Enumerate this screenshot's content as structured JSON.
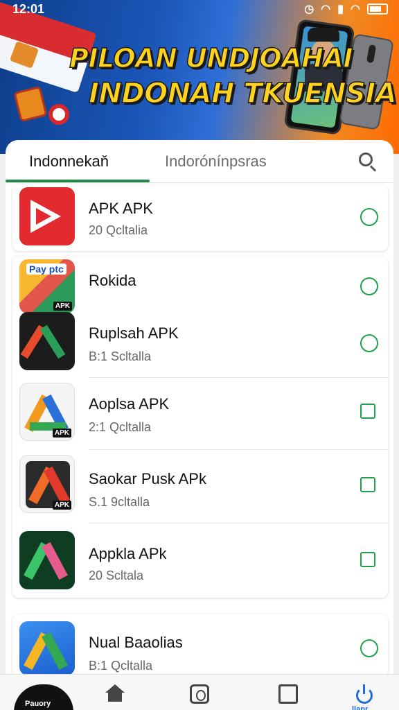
{
  "status_bar": {
    "time": "12:01",
    "icons": [
      "alarm-icon",
      "wifi-icon",
      "signal-icon",
      "wifi-icon",
      "battery-icon"
    ]
  },
  "banner": {
    "line1": "PILOAN UNDJOAHAI",
    "line2": "INDONAH TKUENSIA"
  },
  "tabs": [
    {
      "label": "Indonnekaň",
      "active": true
    },
    {
      "label": "Indorónínpsras",
      "active": false
    }
  ],
  "apps": [
    {
      "name": "APK APK",
      "sub": "20 Qcltalia",
      "action": "heart-icon"
    },
    {
      "name": "Rokida",
      "sub": "",
      "badge": "Pay ptc",
      "action": "heart-icon"
    },
    {
      "name": "Ruplsah APK",
      "sub": "B:1 Scltalla",
      "action": "heart-icon"
    },
    {
      "name": "Aoplsa APK",
      "sub": "2:1 Qcltalla",
      "action": "square-icon"
    },
    {
      "name": "Saokar Pusk APk",
      "sub": "S.1 9cltalla",
      "action": "square-icon"
    },
    {
      "name": "Appkla APk",
      "sub": "20 Scltala",
      "action": "square-icon"
    },
    {
      "name": "Nual Baaolias",
      "sub": "B:1 Qcltalla",
      "action": "heart-icon"
    }
  ],
  "apk_tag": "APK",
  "bottom_nav": {
    "logo_text": "Pauory",
    "power_label": "llapr"
  },
  "colors": {
    "accent_green": "#1f8a44",
    "action_green": "#21a04c",
    "nav_blue": "#1e6ed8"
  }
}
